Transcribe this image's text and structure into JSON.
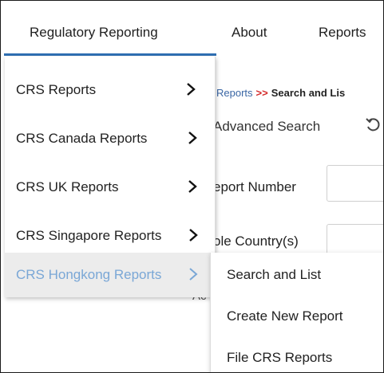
{
  "topnav": {
    "items": [
      {
        "label": "Regulatory Reporting",
        "active": true
      },
      {
        "label": "About",
        "active": false
      },
      {
        "label": "Reports",
        "active": false
      }
    ],
    "accent_color": "#2f6fb2"
  },
  "page": {
    "breadcrumb": {
      "link": "Reports",
      "separator": ">>",
      "current": "Search and Lis"
    },
    "advanced_search_label": "Advanced Search",
    "fields": [
      {
        "label": "eport Number"
      },
      {
        "label": "ole Country(s)"
      }
    ],
    "partial_text": "Ac"
  },
  "dropdown": {
    "items": [
      {
        "label": "CRS Reports",
        "chevron": ">",
        "highlighted": false
      },
      {
        "label": "CRS Canada Reports",
        "chevron": ">",
        "highlighted": false
      },
      {
        "label": "CRS UK Reports",
        "chevron": ">",
        "highlighted": false
      },
      {
        "label": "CRS Singapore Reports",
        "chevron": ">",
        "highlighted": false
      },
      {
        "label": "CRS Hongkong Reports",
        "chevron": ">",
        "highlighted": true
      }
    ],
    "highlight_text_color": "#7aa7d6",
    "highlight_bg_color": "#ececec"
  },
  "submenu": {
    "items": [
      {
        "label": "Search and List"
      },
      {
        "label": "Create New Report"
      },
      {
        "label": "File CRS Reports"
      }
    ]
  }
}
